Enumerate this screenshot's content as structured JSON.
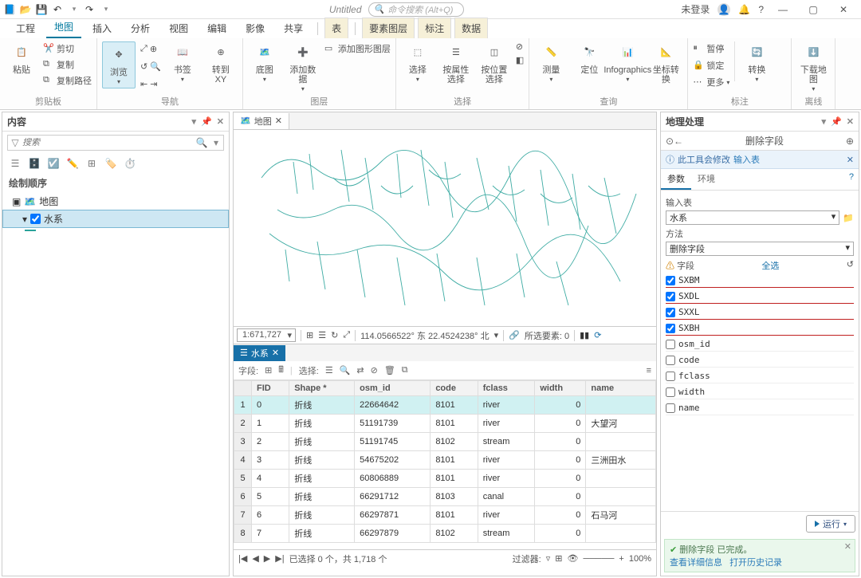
{
  "title": "Untitled",
  "search_placeholder": "命令搜索 (Alt+Q)",
  "login_state": "未登录",
  "ribbon_tabs": [
    "工程",
    "地图",
    "插入",
    "分析",
    "视图",
    "编辑",
    "影像",
    "共享"
  ],
  "context_tabs": [
    "表",
    "要素图层",
    "标注",
    "数据"
  ],
  "active_tab": "地图",
  "ribbon": {
    "clipboard": {
      "title": "剪贴板",
      "paste": "粘贴",
      "cut": "剪切",
      "copy": "复制",
      "copypath": "复制路径"
    },
    "nav": {
      "title": "导航",
      "browse": "浏览",
      "bookmark": "书签",
      "gotoxy": "转到\nXY"
    },
    "layer": {
      "title": "图层",
      "basemap": "底图",
      "adddata": "添加数据",
      "addgraphic": "添加图形图层"
    },
    "selection": {
      "title": "选择",
      "select": "选择",
      "selectbyattr": "按属性选择",
      "selectbyloc": "按位置选择"
    },
    "inquiry": {
      "title": "查询",
      "measure": "测量",
      "locate": "定位",
      "infographics": "Infographics",
      "coordconv": "坐标转换"
    },
    "label": {
      "title": "标注",
      "pause": "暂停",
      "lock": "锁定",
      "more": "更多",
      "convert": "转换"
    },
    "offline": {
      "title": "离线",
      "download": "下载地图"
    }
  },
  "contents": {
    "title": "内容",
    "search_placeholder": "搜索",
    "draw_order": "绘制顺序",
    "map_name": "地图",
    "layer_name": "水系"
  },
  "map": {
    "tab": "地图",
    "scale": "1:671,727",
    "coords": "114.0566522° 东 22.4524238° 北",
    "selected_label": "所选要素: 0"
  },
  "table": {
    "tab": "水系",
    "field_label": "字段:",
    "select_label": "选择:",
    "columns": [
      "",
      "FID",
      "Shape *",
      "osm_id",
      "code",
      "fclass",
      "width",
      "name"
    ],
    "rows": [
      {
        "n": 1,
        "fid": 0,
        "shape": "折线",
        "osm": "22664642",
        "code": 8101,
        "fclass": "river",
        "width": 0,
        "name": ""
      },
      {
        "n": 2,
        "fid": 1,
        "shape": "折线",
        "osm": "51191739",
        "code": 8101,
        "fclass": "river",
        "width": 0,
        "name": "大望河"
      },
      {
        "n": 3,
        "fid": 2,
        "shape": "折线",
        "osm": "51191745",
        "code": 8102,
        "fclass": "stream",
        "width": 0,
        "name": ""
      },
      {
        "n": 4,
        "fid": 3,
        "shape": "折线",
        "osm": "54675202",
        "code": 8101,
        "fclass": "river",
        "width": 0,
        "name": "三洲田水"
      },
      {
        "n": 5,
        "fid": 4,
        "shape": "折线",
        "osm": "60806889",
        "code": 8101,
        "fclass": "river",
        "width": 0,
        "name": ""
      },
      {
        "n": 6,
        "fid": 5,
        "shape": "折线",
        "osm": "66291712",
        "code": 8103,
        "fclass": "canal",
        "width": 0,
        "name": ""
      },
      {
        "n": 7,
        "fid": 6,
        "shape": "折线",
        "osm": "66297871",
        "code": 8101,
        "fclass": "river",
        "width": 0,
        "name": "石马河"
      },
      {
        "n": 8,
        "fid": 7,
        "shape": "折线",
        "osm": "66297879",
        "code": 8102,
        "fclass": "stream",
        "width": 0,
        "name": ""
      }
    ],
    "status": "已选择 0 个，共 1,718 个",
    "filter_label": "过滤器:",
    "zoom": "100%"
  },
  "gp": {
    "title": "地理处理",
    "tool_name": "删除字段",
    "warn": "此工具会修改",
    "warn_link": "输入表",
    "tab_params": "参数",
    "tab_env": "环境",
    "in_table_label": "输入表",
    "in_table_value": "水系",
    "method_label": "方法",
    "method_value": "删除字段",
    "fields_label": "字段",
    "select_all": "全选",
    "fields": [
      {
        "name": "SXBM",
        "checked": true,
        "red": true
      },
      {
        "name": "SXDL",
        "checked": true,
        "red": true
      },
      {
        "name": "SXXL",
        "checked": true,
        "red": true
      },
      {
        "name": "SXBH",
        "checked": true,
        "red": true
      },
      {
        "name": "osm_id",
        "checked": false,
        "red": false
      },
      {
        "name": "code",
        "checked": false,
        "red": false
      },
      {
        "name": "fclass",
        "checked": false,
        "red": false
      },
      {
        "name": "width",
        "checked": false,
        "red": false
      },
      {
        "name": "name",
        "checked": false,
        "red": false
      }
    ],
    "run": "运行",
    "msg_title": "删除字段 已完成。",
    "msg_link1": "查看详细信息",
    "msg_link2": "打开历史记录"
  }
}
